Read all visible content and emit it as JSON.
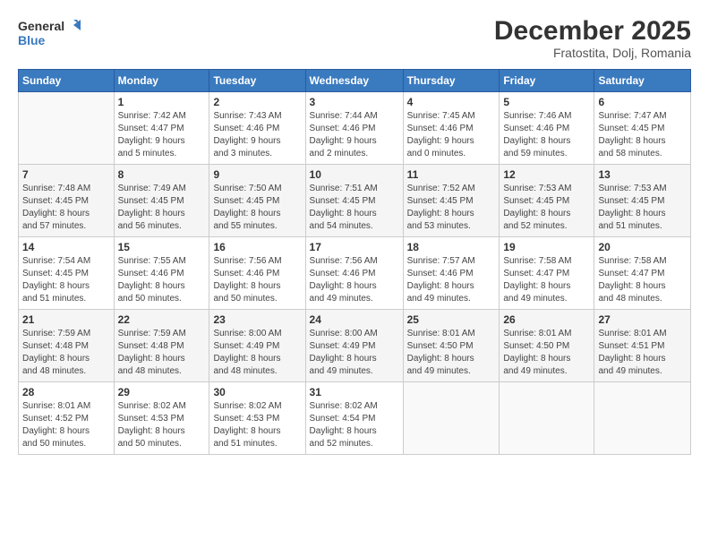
{
  "header": {
    "logo_line1": "General",
    "logo_line2": "Blue",
    "main_title": "December 2025",
    "subtitle": "Fratostita, Dolj, Romania"
  },
  "calendar": {
    "days_of_week": [
      "Sunday",
      "Monday",
      "Tuesday",
      "Wednesday",
      "Thursday",
      "Friday",
      "Saturday"
    ],
    "weeks": [
      [
        {
          "num": "",
          "info": ""
        },
        {
          "num": "1",
          "info": "Sunrise: 7:42 AM\nSunset: 4:47 PM\nDaylight: 9 hours\nand 5 minutes."
        },
        {
          "num": "2",
          "info": "Sunrise: 7:43 AM\nSunset: 4:46 PM\nDaylight: 9 hours\nand 3 minutes."
        },
        {
          "num": "3",
          "info": "Sunrise: 7:44 AM\nSunset: 4:46 PM\nDaylight: 9 hours\nand 2 minutes."
        },
        {
          "num": "4",
          "info": "Sunrise: 7:45 AM\nSunset: 4:46 PM\nDaylight: 9 hours\nand 0 minutes."
        },
        {
          "num": "5",
          "info": "Sunrise: 7:46 AM\nSunset: 4:46 PM\nDaylight: 8 hours\nand 59 minutes."
        },
        {
          "num": "6",
          "info": "Sunrise: 7:47 AM\nSunset: 4:45 PM\nDaylight: 8 hours\nand 58 minutes."
        }
      ],
      [
        {
          "num": "7",
          "info": "Sunrise: 7:48 AM\nSunset: 4:45 PM\nDaylight: 8 hours\nand 57 minutes."
        },
        {
          "num": "8",
          "info": "Sunrise: 7:49 AM\nSunset: 4:45 PM\nDaylight: 8 hours\nand 56 minutes."
        },
        {
          "num": "9",
          "info": "Sunrise: 7:50 AM\nSunset: 4:45 PM\nDaylight: 8 hours\nand 55 minutes."
        },
        {
          "num": "10",
          "info": "Sunrise: 7:51 AM\nSunset: 4:45 PM\nDaylight: 8 hours\nand 54 minutes."
        },
        {
          "num": "11",
          "info": "Sunrise: 7:52 AM\nSunset: 4:45 PM\nDaylight: 8 hours\nand 53 minutes."
        },
        {
          "num": "12",
          "info": "Sunrise: 7:53 AM\nSunset: 4:45 PM\nDaylight: 8 hours\nand 52 minutes."
        },
        {
          "num": "13",
          "info": "Sunrise: 7:53 AM\nSunset: 4:45 PM\nDaylight: 8 hours\nand 51 minutes."
        }
      ],
      [
        {
          "num": "14",
          "info": "Sunrise: 7:54 AM\nSunset: 4:45 PM\nDaylight: 8 hours\nand 51 minutes."
        },
        {
          "num": "15",
          "info": "Sunrise: 7:55 AM\nSunset: 4:46 PM\nDaylight: 8 hours\nand 50 minutes."
        },
        {
          "num": "16",
          "info": "Sunrise: 7:56 AM\nSunset: 4:46 PM\nDaylight: 8 hours\nand 50 minutes."
        },
        {
          "num": "17",
          "info": "Sunrise: 7:56 AM\nSunset: 4:46 PM\nDaylight: 8 hours\nand 49 minutes."
        },
        {
          "num": "18",
          "info": "Sunrise: 7:57 AM\nSunset: 4:46 PM\nDaylight: 8 hours\nand 49 minutes."
        },
        {
          "num": "19",
          "info": "Sunrise: 7:58 AM\nSunset: 4:47 PM\nDaylight: 8 hours\nand 49 minutes."
        },
        {
          "num": "20",
          "info": "Sunrise: 7:58 AM\nSunset: 4:47 PM\nDaylight: 8 hours\nand 48 minutes."
        }
      ],
      [
        {
          "num": "21",
          "info": "Sunrise: 7:59 AM\nSunset: 4:48 PM\nDaylight: 8 hours\nand 48 minutes."
        },
        {
          "num": "22",
          "info": "Sunrise: 7:59 AM\nSunset: 4:48 PM\nDaylight: 8 hours\nand 48 minutes."
        },
        {
          "num": "23",
          "info": "Sunrise: 8:00 AM\nSunset: 4:49 PM\nDaylight: 8 hours\nand 48 minutes."
        },
        {
          "num": "24",
          "info": "Sunrise: 8:00 AM\nSunset: 4:49 PM\nDaylight: 8 hours\nand 49 minutes."
        },
        {
          "num": "25",
          "info": "Sunrise: 8:01 AM\nSunset: 4:50 PM\nDaylight: 8 hours\nand 49 minutes."
        },
        {
          "num": "26",
          "info": "Sunrise: 8:01 AM\nSunset: 4:50 PM\nDaylight: 8 hours\nand 49 minutes."
        },
        {
          "num": "27",
          "info": "Sunrise: 8:01 AM\nSunset: 4:51 PM\nDaylight: 8 hours\nand 49 minutes."
        }
      ],
      [
        {
          "num": "28",
          "info": "Sunrise: 8:01 AM\nSunset: 4:52 PM\nDaylight: 8 hours\nand 50 minutes."
        },
        {
          "num": "29",
          "info": "Sunrise: 8:02 AM\nSunset: 4:53 PM\nDaylight: 8 hours\nand 50 minutes."
        },
        {
          "num": "30",
          "info": "Sunrise: 8:02 AM\nSunset: 4:53 PM\nDaylight: 8 hours\nand 51 minutes."
        },
        {
          "num": "31",
          "info": "Sunrise: 8:02 AM\nSunset: 4:54 PM\nDaylight: 8 hours\nand 52 minutes."
        },
        {
          "num": "",
          "info": ""
        },
        {
          "num": "",
          "info": ""
        },
        {
          "num": "",
          "info": ""
        }
      ]
    ]
  }
}
